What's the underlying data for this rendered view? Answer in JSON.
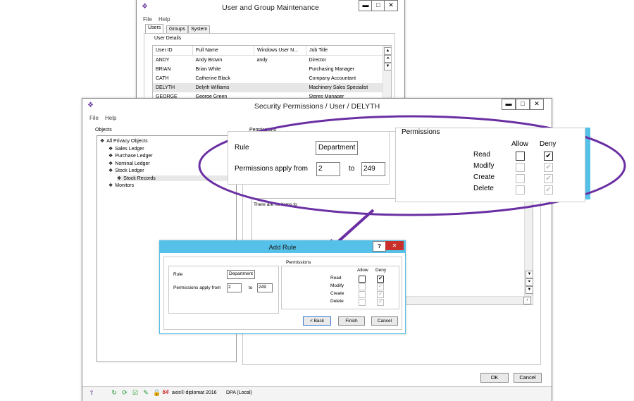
{
  "user_window": {
    "title": "User and Group Maintenance",
    "menu": [
      "File",
      "Help"
    ],
    "tabs": [
      "Users",
      "Groups",
      "System"
    ],
    "section_label": "User Details",
    "columns": [
      "User ID",
      "Full Name",
      "Windows User N...",
      "Job Title"
    ],
    "rows": [
      {
        "id": "ANDY",
        "name": "Andy Brown",
        "win": "andy",
        "job": "Director"
      },
      {
        "id": "BRIAN",
        "name": "Brian White",
        "win": "",
        "job": "Purchasing Manager"
      },
      {
        "id": "CATH",
        "name": "Catherine Black",
        "win": "",
        "job": "Company Accountant"
      },
      {
        "id": "DELYTH",
        "name": "Delyth Williams",
        "win": "",
        "job": "Machinery Sales Specialist"
      },
      {
        "id": "GEORGE",
        "name": "George Green",
        "win": "",
        "job": "Stores Manager"
      }
    ]
  },
  "sec_window": {
    "title": "Security Permissions / User / DELYTH",
    "menu": [
      "File",
      "Help"
    ],
    "objects_label": "Objects",
    "tree": [
      {
        "label": "All Privacy Objects",
        "level": 0
      },
      {
        "label": "Sales Ledger",
        "level": 1
      },
      {
        "label": "Purchase Ledger",
        "level": 1
      },
      {
        "label": "Nominal Ledger",
        "level": 1
      },
      {
        "label": "Stock Ledger",
        "level": 1
      },
      {
        "label": "Stock Records",
        "level": 2
      },
      {
        "label": "Monitors",
        "level": 1
      }
    ],
    "permissions_label": "Permissions",
    "empty_text": "There are no items to",
    "ok": "OK",
    "cancel": "Cancel",
    "status_product": "axis® diplomat 2016",
    "status_db": "DPA (Local)",
    "status_badge": "64"
  },
  "zoom": {
    "rule_label": "Rule",
    "rule_value": "Department",
    "apply_label": "Permissions apply from",
    "from": "2",
    "to_label": "to",
    "to": "249",
    "perm_label": "Permissions",
    "allow": "Allow",
    "deny": "Deny",
    "rows": [
      {
        "label": "Read",
        "allow": false,
        "deny": true,
        "enabled": true
      },
      {
        "label": "Modify",
        "allow": false,
        "deny": true,
        "enabled": false
      },
      {
        "label": "Create",
        "allow": false,
        "deny": true,
        "enabled": false
      },
      {
        "label": "Delete",
        "allow": false,
        "deny": true,
        "enabled": false
      }
    ]
  },
  "dialog": {
    "title": "Add Rule",
    "rule_label": "Rule",
    "rule_value": "Department",
    "apply_label": "Permissions apply from",
    "from": "2",
    "to_label": "to",
    "to": "249",
    "perm_label": "Permissions",
    "allow": "Allow",
    "deny": "Deny",
    "rows": [
      "Read",
      "Modify",
      "Create",
      "Delete"
    ],
    "back": "< Back",
    "finish": "Finish",
    "cancel": "Cancel",
    "help_glyph": "?",
    "close_glyph": "✕"
  },
  "colors": {
    "accent": "#55c0e8",
    "callout": "#6a2fa3",
    "close_red": "#c9302c"
  }
}
